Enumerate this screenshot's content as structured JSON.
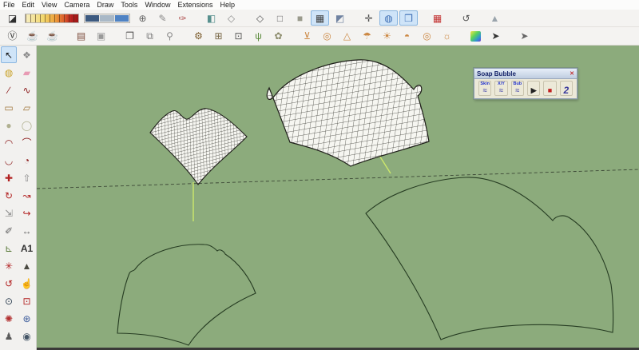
{
  "colors": {
    "menubar-bg": "#fcfcfb",
    "toolbar-bg": "#f4f3f1",
    "palette-bg": "#f2f1ef",
    "sel-bg": "#cfe4f8",
    "sel-border": "#8ab6e0",
    "viewport-bg": "#8cab7c",
    "axis-line": "#3c4836",
    "helper-line": "#cde86b",
    "mesh-fill": "#f6f6f1",
    "mesh-grid": "#2e2e28",
    "mesh-edge": "#1e1e19",
    "outline-stroke": "#263c22",
    "bottom-edge": "#3a3a38",
    "dialog-bg": "#ece9d8",
    "dialog-title-from": "#e6eef8",
    "dialog-title-to": "#bfcde0",
    "dialog-title-text": "#16246a"
  },
  "menu": {
    "items": [
      "File",
      "Edit",
      "View",
      "Camera",
      "Draw",
      "Tools",
      "Window",
      "Extensions",
      "Help"
    ]
  },
  "toolbar_row1": {
    "lead": [
      {
        "name": "eraser-block-icon",
        "glyph": "◪",
        "color": "#2e2e2e"
      }
    ],
    "items": [
      {
        "name": "place-north-icon",
        "glyph": "⊕",
        "color": "#666666"
      },
      {
        "name": "pencil-tool-icon",
        "glyph": "✎",
        "color": "#8a8a8a"
      },
      {
        "name": "red-marker-icon",
        "glyph": "✑",
        "color": "#b05050"
      },
      {
        "name": "gap-1",
        "glyph": "",
        "gap": true
      },
      {
        "name": "xray-style-cube-icon",
        "glyph": "◧",
        "color": "#58908e"
      },
      {
        "name": "back-edges-cube-icon",
        "glyph": "◇",
        "color": "#8a8a8a"
      },
      {
        "name": "gap-2",
        "glyph": "",
        "gap": true
      },
      {
        "name": "wireframe-cube-icon",
        "glyph": "◇",
        "color": "#555555"
      },
      {
        "name": "hidden-line-cube-icon",
        "glyph": "□",
        "color": "#6a6a6a"
      },
      {
        "name": "shaded-cube-icon",
        "glyph": "■",
        "color": "#9a9a8c"
      },
      {
        "name": "shaded-textures-cube-icon",
        "glyph": "▦",
        "color": "#3e3e3e",
        "sel": true
      },
      {
        "name": "monochrome-cube-icon",
        "glyph": "◩",
        "color": "#6f82a0"
      },
      {
        "name": "gap-3",
        "glyph": "",
        "gap": true
      },
      {
        "name": "axes-compass-icon",
        "glyph": "✛",
        "color": "#4a4a4a"
      },
      {
        "name": "globe-texture-icon",
        "glyph": "◍",
        "color": "#3f6fb5",
        "sel": true
      },
      {
        "name": "globe-box-icon",
        "glyph": "❒",
        "color": "#3f6fb5",
        "sel": true
      },
      {
        "name": "gap-4",
        "glyph": "",
        "gap": true
      },
      {
        "name": "red-grid-icon",
        "glyph": "▦",
        "color": "#c23030"
      },
      {
        "name": "gap-5",
        "glyph": "",
        "gap": true
      },
      {
        "name": "undo-arc-icon",
        "glyph": "↺",
        "color": "#555555"
      },
      {
        "name": "gap-6",
        "glyph": "",
        "gap": true
      },
      {
        "name": "flip-triangle-icon",
        "glyph": "▲",
        "color": "#9aa4ac"
      }
    ]
  },
  "toolbar_row2": {
    "items": [
      {
        "name": "v-circle-icon",
        "glyph": "Ⓥ",
        "color": "#333333"
      },
      {
        "name": "teapot-icon",
        "glyph": "☕",
        "color": "#5a5a5a"
      },
      {
        "name": "teapot-paint-icon",
        "glyph": "☕",
        "color": "#7a5a3a"
      },
      {
        "name": "gap-1",
        "glyph": "",
        "gap": true
      },
      {
        "name": "table-tool-icon",
        "glyph": "▤",
        "color": "#7a4a3a"
      },
      {
        "name": "frame-tool-icon",
        "glyph": "▣",
        "color": "#999999"
      },
      {
        "name": "gap-2",
        "glyph": "",
        "gap": true
      },
      {
        "name": "window-icon",
        "glyph": "❐",
        "color": "#555555"
      },
      {
        "name": "window-copy-icon",
        "glyph": "⧉",
        "color": "#777777"
      },
      {
        "name": "lock-icon",
        "glyph": "⚲",
        "color": "#8a8a8a"
      },
      {
        "name": "gap-3",
        "glyph": "",
        "gap": true
      },
      {
        "name": "lamp-tool-icon",
        "glyph": "⚙",
        "color": "#7a5a2a"
      },
      {
        "name": "box-add-icon",
        "glyph": "⊞",
        "color": "#7a6a4a"
      },
      {
        "name": "box-wire-icon",
        "glyph": "⊡",
        "color": "#555555"
      },
      {
        "name": "grass-tool-icon",
        "glyph": "ψ",
        "color": "#5a8a3a"
      },
      {
        "name": "leaf-shell-icon",
        "glyph": "✿",
        "color": "#8a8a6a"
      },
      {
        "name": "gap-4",
        "glyph": "",
        "gap": true
      },
      {
        "name": "funnel-tool-icon",
        "glyph": "⊻",
        "color": "#cc8844"
      },
      {
        "name": "donut-tool-icon",
        "glyph": "◎",
        "color": "#cc8844"
      },
      {
        "name": "cone-tool-icon",
        "glyph": "△",
        "color": "#cc8844"
      },
      {
        "name": "tripod-tool-icon",
        "glyph": "☂",
        "color": "#cc8844"
      },
      {
        "name": "sun-tool-icon",
        "glyph": "☀",
        "color": "#cc8844"
      },
      {
        "name": "dome-tool-icon",
        "glyph": "◓",
        "color": "#cc8844"
      },
      {
        "name": "torus-tool-icon",
        "glyph": "◎",
        "color": "#cc8844"
      },
      {
        "name": "sun-bracket-icon",
        "glyph": "☼",
        "color": "#cc8844"
      },
      {
        "name": "gap-5",
        "glyph": "",
        "gap": true
      },
      {
        "name": "gradient-swatch-icon",
        "glyph": "▣",
        "swatch": true
      },
      {
        "name": "cursor-star-icon",
        "glyph": "➤",
        "color": "#333333"
      },
      {
        "name": "gap-6",
        "glyph": "",
        "gap": true
      },
      {
        "name": "cursor-icon",
        "glyph": "➤",
        "color": "#666666"
      }
    ]
  },
  "palette": {
    "items": [
      {
        "name": "select-tool",
        "glyph": "↖",
        "color": "#111111",
        "sel": true
      },
      {
        "name": "make-component-tool",
        "glyph": "❖",
        "color": "#8a8a8a"
      },
      {
        "name": "paint-bucket-tool",
        "glyph": "◍",
        "color": "#c9a227"
      },
      {
        "name": "eraser-tool",
        "glyph": "▰",
        "color": "#e89bb4"
      },
      {
        "name": "line-tool",
        "glyph": "∕",
        "color": "#8b1a1a"
      },
      {
        "name": "freehand-tool",
        "glyph": "∿",
        "color": "#8b1a1a"
      },
      {
        "name": "rectangle-tool",
        "glyph": "▭",
        "color": "#a0763a"
      },
      {
        "name": "rotated-rectangle-tool",
        "glyph": "▱",
        "color": "#a0763a"
      },
      {
        "name": "circle-tool",
        "glyph": "●",
        "color": "#b0b090"
      },
      {
        "name": "polygon-tool",
        "glyph": "◯",
        "color": "#b0b090"
      },
      {
        "name": "arc-tool",
        "glyph": "◠",
        "color": "#8b1a1a"
      },
      {
        "name": "two-point-arc-tool",
        "glyph": "⌒",
        "color": "#8b1a1a"
      },
      {
        "name": "three-point-arc-tool",
        "glyph": "◡",
        "color": "#8b1a1a"
      },
      {
        "name": "pie-tool",
        "glyph": "◔",
        "color": "#8b1a1a"
      },
      {
        "name": "move-tool",
        "glyph": "✚",
        "color": "#b22222"
      },
      {
        "name": "push-pull-tool",
        "glyph": "⇧",
        "color": "#888888"
      },
      {
        "name": "rotate-tool",
        "glyph": "↻",
        "color": "#b22222"
      },
      {
        "name": "follow-me-tool",
        "glyph": "↝",
        "color": "#b22222"
      },
      {
        "name": "scale-tool",
        "glyph": "⇲",
        "color": "#8a8a8a"
      },
      {
        "name": "offset-tool",
        "glyph": "↪",
        "color": "#b22222"
      },
      {
        "name": "tape-measure-tool",
        "glyph": "✐",
        "color": "#666666"
      },
      {
        "name": "dimension-tool",
        "glyph": "↔",
        "color": "#666666"
      },
      {
        "name": "protractor-tool",
        "glyph": "⊾",
        "color": "#5a7a3a"
      },
      {
        "name": "text-tool",
        "glyph": "A1",
        "color": "#333333",
        "txt": true
      },
      {
        "name": "axes-tool",
        "glyph": "✳",
        "color": "#b22222"
      },
      {
        "name": "sandbox-tool",
        "glyph": "▲",
        "color": "#4a4a42"
      },
      {
        "name": "orbit-tool",
        "glyph": "↺",
        "color": "#b22222"
      },
      {
        "name": "pan-tool",
        "glyph": "☝",
        "color": "#c8b088"
      },
      {
        "name": "zoom-tool",
        "glyph": "⊙",
        "color": "#334455"
      },
      {
        "name": "zoom-window-tool",
        "glyph": "⊡",
        "color": "#b22222"
      },
      {
        "name": "zoom-extents-tool",
        "glyph": "✺",
        "color": "#b23030"
      },
      {
        "name": "previous-view-tool",
        "glyph": "⊛",
        "color": "#3a5a9a"
      },
      {
        "name": "position-camera-tool",
        "glyph": "♟",
        "color": "#5a5a5a"
      },
      {
        "name": "look-around-tool",
        "glyph": "◉",
        "color": "#445566"
      }
    ]
  },
  "dialog": {
    "title": "Soap Bubble",
    "close_glyph": "✕",
    "buttons": [
      {
        "name": "skin-button",
        "label": "Skin",
        "glyph": "≈",
        "glyph_color": "#5a5ab0"
      },
      {
        "name": "xy-button",
        "label": "X/Y",
        "glyph": "≈",
        "glyph_color": "#5a5ab0"
      },
      {
        "name": "bub-button",
        "label": "Bub",
        "glyph": "≈",
        "glyph_color": "#5a5ab0"
      },
      {
        "name": "play-button",
        "label": "",
        "glyph": "▶",
        "glyph_color": "#222222"
      },
      {
        "name": "stop-button",
        "label": "",
        "glyph": "■",
        "glyph_color": "#c22222"
      },
      {
        "name": "undo-2-button",
        "label": "",
        "glyph": "2",
        "glyph_color": "#3a3a9c",
        "big": true
      }
    ]
  }
}
